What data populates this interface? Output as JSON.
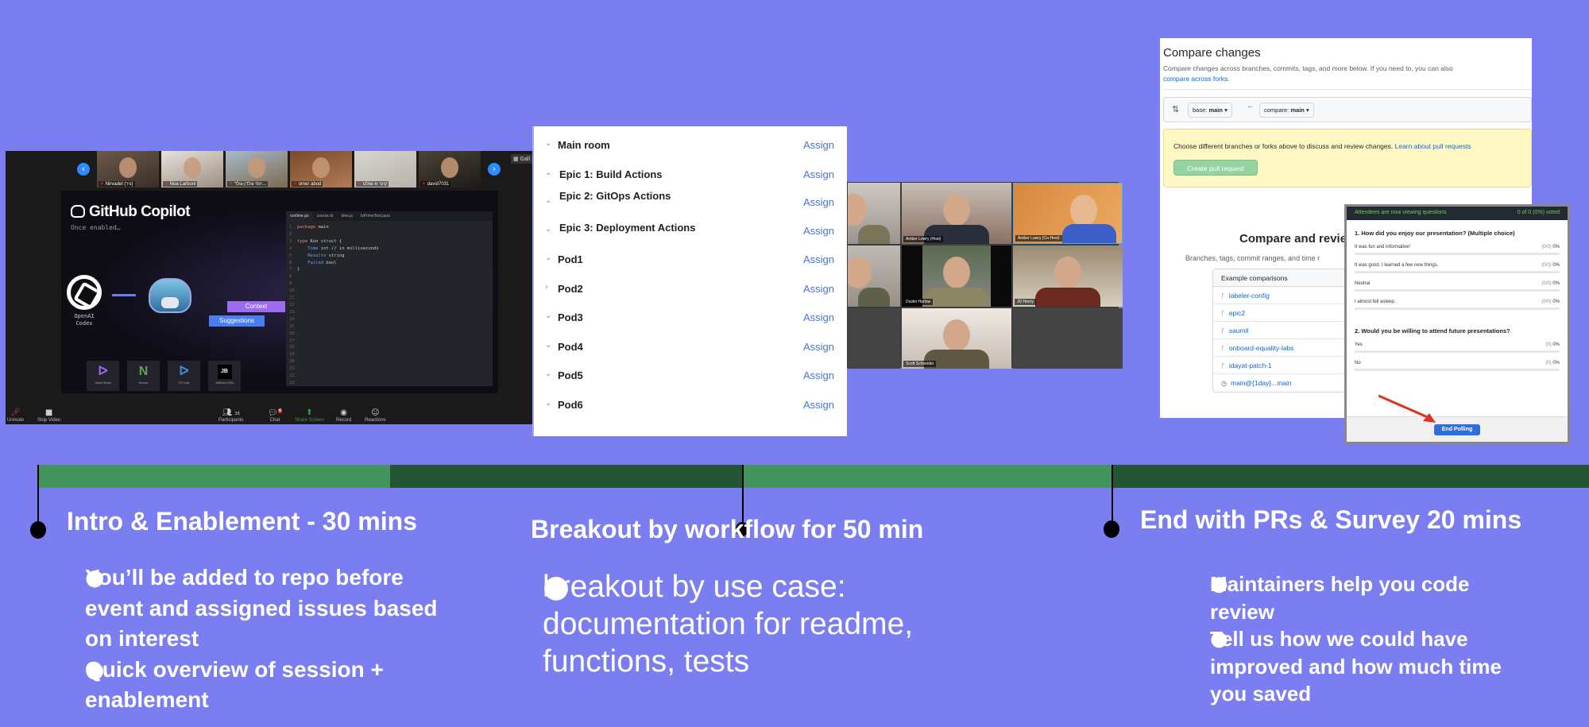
{
  "zoom_meeting": {
    "gallery": {
      "prev_icon": "chevron-left-icon",
      "next_icon": "chevron-right-icon",
      "participants": [
        "Nirvadel (ניר)",
        "Noa Larboni",
        "יוסי גולדן-גולד...",
        "omer abod",
        "קינר א שולט",
        "david7031"
      ],
      "view_label": "Gall"
    },
    "slide": {
      "title": "GitHub Copilot",
      "subtitle": "Once enabled…",
      "openai_label_1": "OpenAI",
      "openai_label_2": "Codex",
      "context_label": "Context",
      "suggestions_label": "Suggestions",
      "ides": [
        {
          "label": "Visual Studio",
          "icon": "ᐅ",
          "color": "#9b6cf0"
        },
        {
          "label": "Neovim",
          "icon": "N",
          "color": "#5aa64a"
        },
        {
          "label": "VS Code",
          "icon": "ᐅ",
          "color": "#3f8fe8"
        },
        {
          "label": "JetBrains IDEs",
          "icon": "JB",
          "color": "#ffffff"
        }
      ],
      "code_tabs": [
        "runtime.go",
        "course.rb",
        "time.js",
        "IsPrimeTest.java"
      ],
      "code": [
        {
          "n": "1",
          "k": "package",
          "t": " main"
        },
        {
          "n": "2",
          "k": "",
          "t": ""
        },
        {
          "n": "3",
          "k": "type",
          "t": " Run struct {"
        },
        {
          "n": "4",
          "f": "Time",
          "t": " int // in milliseconds"
        },
        {
          "n": "5",
          "f": "Results",
          "t": " string"
        },
        {
          "n": "6",
          "f": "Failed",
          "t": " bool"
        },
        {
          "n": "7",
          "k": "",
          "t": "}"
        }
      ],
      "empty_line_numbers": [
        "8",
        "9",
        "10",
        "11",
        "12",
        "13",
        "14",
        "15",
        "16",
        "17",
        "18",
        "19",
        "20",
        "21",
        "22",
        "23"
      ]
    },
    "toolbar": {
      "unmute": "Unmute",
      "stop_video": "Stop Video",
      "participants": "Participants",
      "participants_count": "38",
      "chat": "Chat",
      "chat_badge": "4",
      "share_screen": "Share Screen",
      "record": "Record",
      "reactions": "Reactions"
    }
  },
  "breakout_rooms": {
    "assign_label": "Assign",
    "rooms": [
      {
        "name": "Main room",
        "expanded": true
      },
      {
        "name": "Epic 1: Build Actions",
        "expanded": true
      },
      {
        "name": "Epic 2: GitOps Actions",
        "expanded": true
      },
      {
        "name": "Epic 3: Deployment Actions",
        "expanded": true
      },
      {
        "name": "Pod1",
        "expanded": true
      },
      {
        "name": "Pod2",
        "expanded": false
      },
      {
        "name": "Pod3",
        "expanded": true
      },
      {
        "name": "Pod4",
        "expanded": true
      },
      {
        "name": "Pod5",
        "expanded": true
      },
      {
        "name": "Pod6",
        "expanded": true
      }
    ]
  },
  "video_grid": {
    "tiles": [
      "",
      "Amber Lowry (Host)",
      "Amber Lowry (Co-Host)",
      "",
      "Dustin Harlow",
      "JD Henry",
      "",
      "Scott Schneider",
      ""
    ]
  },
  "github_compare": {
    "title": "Compare changes",
    "description": "Compare changes across branches, commits, tags, and more below. If you need to, you can also",
    "forks_link": "compare across forks.",
    "base_label": "base:",
    "base_value": "main",
    "compare_label": "compare:",
    "compare_value": "main",
    "notice_text": "Choose different branches or forks above to discuss and review changes.",
    "notice_link": "Learn about pull requests",
    "create_pr_button": "Create pull request",
    "section_title": "Compare and revie",
    "section_sub": "Branches, tags, commit ranges, and time r",
    "examples_header": "Example comparisons",
    "examples": [
      {
        "icon": "branch-icon",
        "label": "labeler-config"
      },
      {
        "icon": "branch-icon",
        "label": "epic2"
      },
      {
        "icon": "branch-icon",
        "label": "saumil"
      },
      {
        "icon": "branch-icon",
        "label": "onboard-equality-labs"
      },
      {
        "icon": "branch-icon",
        "label": "idayat-patch-1"
      },
      {
        "icon": "clock-icon",
        "label": "main@{1day}...main"
      }
    ]
  },
  "poll": {
    "status": "Attendees are now viewing questions",
    "voted": "0 of 0 (0%) voted",
    "questions": [
      {
        "question": "1. How did you enjoy our presentation? (Multiple choice)",
        "options": [
          {
            "label": "It was fun and informative!",
            "count": "(0/0)",
            "pct": "0%",
            "fraction": 0
          },
          {
            "label": "It was good. I learned a few new things.",
            "count": "(0/0)",
            "pct": "0%",
            "fraction": 0
          },
          {
            "label": "Neutral",
            "count": "(0/0)",
            "pct": "0%",
            "fraction": 0
          },
          {
            "label": "I almost fell asleep.",
            "count": "(0/0)",
            "pct": "0%",
            "fraction": 0
          }
        ]
      },
      {
        "question": "2. Would you be willing to attend future presentations?",
        "options": [
          {
            "label": "Yes",
            "count": "(0)",
            "pct": "0%",
            "fraction": 0
          },
          {
            "label": "No",
            "count": "(0)",
            "pct": "0%",
            "fraction": 0
          }
        ]
      }
    ],
    "end_button": "End Polling"
  },
  "timeline": {
    "colors": {
      "light": "#43935c",
      "dark": "#245636"
    },
    "phases": [
      {
        "title": "Intro & Enablement - 30 mins",
        "bullets": [
          "You’ll be added to repo before event and assigned issues based on interest",
          "Quick overview of session + enablement"
        ]
      },
      {
        "title": "Breakout by workflow  for 50 min",
        "bullets": [
          "breakout by use case: documentation for readme, functions, tests"
        ]
      },
      {
        "title": "End with PRs & Survey 20 mins",
        "bullets": [
          "Maintainers help you code review",
          "Tell us how we could have improved and how much time you saved"
        ]
      }
    ]
  }
}
